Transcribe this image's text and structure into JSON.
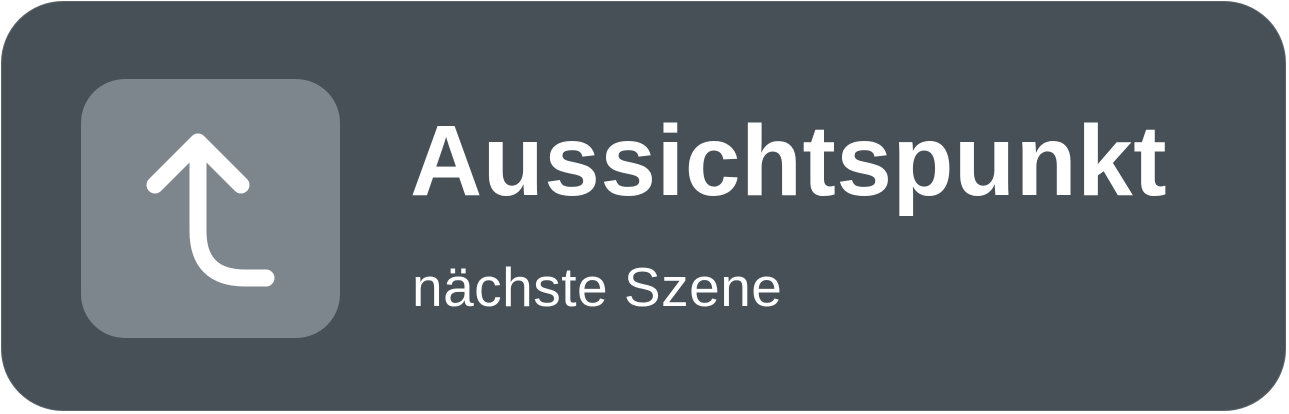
{
  "action": {
    "icon": "turn-left-up-arrow-icon",
    "title": "Aussichtspunkt",
    "subtitle": "nächste Szene"
  },
  "colors": {
    "card_background": "#475057",
    "icon_tile_background": "#7e868d",
    "text": "#ffffff"
  }
}
